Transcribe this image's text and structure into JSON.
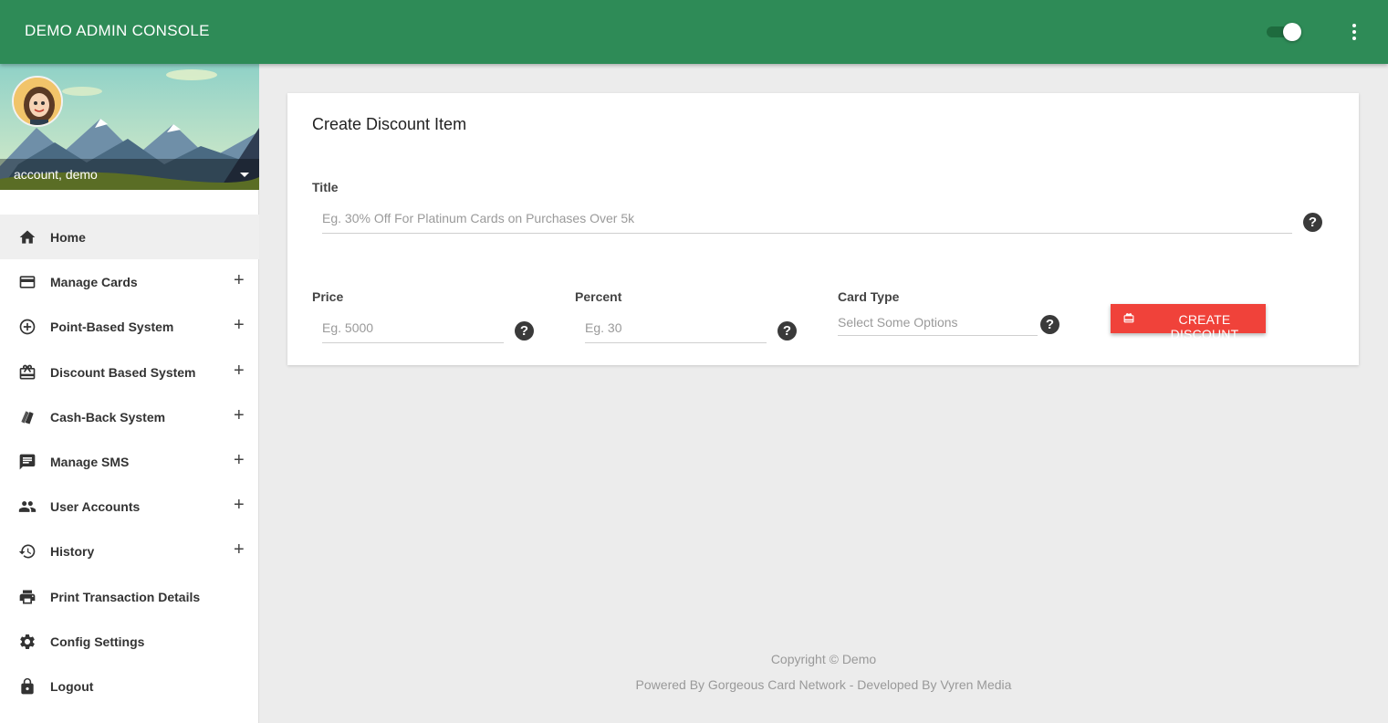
{
  "app": {
    "title": "DEMO ADMIN CONSOLE",
    "theme_toggle_on": true,
    "accent": "#2e8b57",
    "danger": "#f0423a"
  },
  "account": {
    "name": "account, demo"
  },
  "nav": {
    "items": [
      {
        "label": "Home",
        "icon": "home-icon",
        "expandable": false,
        "active": true
      },
      {
        "label": "Manage Cards",
        "icon": "credit-card-icon",
        "expandable": true
      },
      {
        "label": "Point-Based System",
        "icon": "add-circle-icon",
        "expandable": true
      },
      {
        "label": "Discount Based System",
        "icon": "gift-card-icon",
        "expandable": true
      },
      {
        "label": "Cash-Back System",
        "icon": "cash-icon",
        "expandable": true
      },
      {
        "label": "Manage SMS",
        "icon": "message-icon",
        "expandable": true
      },
      {
        "label": "User Accounts",
        "icon": "people-icon",
        "expandable": true
      },
      {
        "label": "History",
        "icon": "history-icon",
        "expandable": true
      },
      {
        "label": "Print Transaction Details",
        "icon": "printer-icon",
        "expandable": false
      },
      {
        "label": "Config Settings",
        "icon": "gear-icon",
        "expandable": false
      },
      {
        "label": "Logout",
        "icon": "lock-icon",
        "expandable": false
      }
    ],
    "expand_glyph": "+"
  },
  "form": {
    "title": "Create Discount Item",
    "title_field": {
      "label": "Title",
      "placeholder": "Eg. 30% Off For Platinum Cards on Purchases Over 5k",
      "value": ""
    },
    "price_field": {
      "label": "Price",
      "placeholder": "Eg. 5000",
      "value": ""
    },
    "percent_field": {
      "label": "Percent",
      "placeholder": "Eg. 30",
      "value": ""
    },
    "card_type_field": {
      "label": "Card Type",
      "placeholder": "Select Some Options"
    },
    "help_glyph": "?",
    "submit_label": "CREATE DISCOUNT"
  },
  "footer": {
    "copyright": "Copyright © Demo",
    "powered_by": "Powered By Gorgeous Card Network - Developed By Vyren Media"
  }
}
